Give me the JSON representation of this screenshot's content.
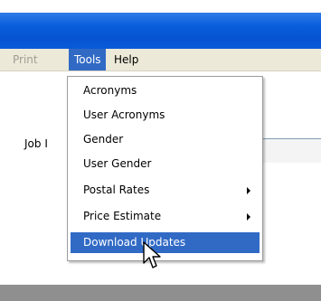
{
  "menubar": {
    "print": "Print",
    "tools": "Tools",
    "help": "Help"
  },
  "form": {
    "job_label": "Job I"
  },
  "tools_menu": {
    "items": [
      {
        "label": "Acronyms",
        "submenu": false
      },
      {
        "label": "User Acronyms",
        "submenu": false
      },
      {
        "label": "Gender",
        "submenu": false
      },
      {
        "label": "User Gender",
        "submenu": false
      },
      {
        "label": "Postal Rates",
        "submenu": true
      },
      {
        "label": "Price Estimate",
        "submenu": true
      },
      {
        "label": "Download Updates",
        "submenu": false,
        "highlighted": true
      }
    ]
  },
  "colors": {
    "titlebar": "#0653d1",
    "menu_highlight": "#316ac5",
    "menubar_bg": "#ece9d8",
    "disabled_text": "#a09d94"
  },
  "icons": {
    "cursor": "arrow-pointer-icon",
    "submenu_arrow": "chevron-right-icon"
  }
}
